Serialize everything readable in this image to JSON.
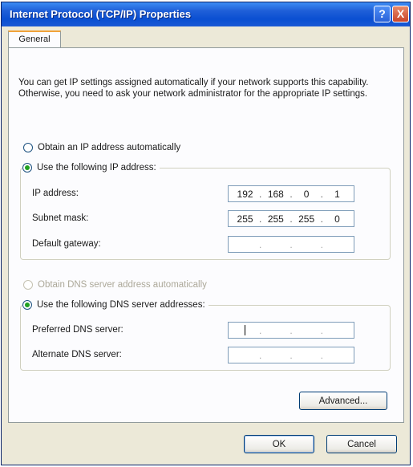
{
  "window": {
    "title": "Internet Protocol (TCP/IP) Properties",
    "help_label": "?",
    "close_label": "X"
  },
  "tabs": [
    {
      "label": "General"
    }
  ],
  "intro_text": "You can get IP settings assigned automatically if your network supports this capability. Otherwise, you need to ask your network administrator for the appropriate IP settings.",
  "ip_options": {
    "auto_label": "Obtain an IP address automatically",
    "manual_label": "Use the following IP address:",
    "selected": "manual"
  },
  "ip_fields": {
    "ip_address": {
      "label": "IP address:",
      "octets": [
        "192",
        "168",
        "0",
        "1"
      ]
    },
    "subnet_mask": {
      "label": "Subnet mask:",
      "octets": [
        "255",
        "255",
        "255",
        "0"
      ]
    },
    "default_gateway": {
      "label": "Default gateway:",
      "octets": [
        "",
        "",
        "",
        ""
      ]
    }
  },
  "dns_options": {
    "auto_label": "Obtain DNS server address automatically",
    "manual_label": "Use the following DNS server addresses:",
    "selected": "manual"
  },
  "dns_fields": {
    "preferred": {
      "label": "Preferred DNS server:",
      "octets": [
        "",
        "",
        "",
        ""
      ]
    },
    "alternate": {
      "label": "Alternate DNS server:",
      "octets": [
        "",
        "",
        "",
        ""
      ]
    }
  },
  "buttons": {
    "advanced": "Advanced...",
    "ok": "OK",
    "cancel": "Cancel"
  }
}
